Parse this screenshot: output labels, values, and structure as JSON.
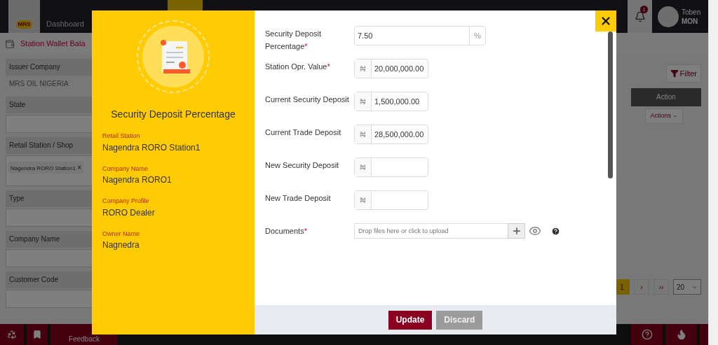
{
  "nav": {
    "logo_text": "MRS",
    "dashboard_label": "Dashboard",
    "notification_count": "1",
    "user": {
      "name": "Toben",
      "role": "MON"
    }
  },
  "page_title": "Station Wallet Bala",
  "filters": [
    {
      "label": "Issuer Company",
      "value": "MRS OIL NIGERIA",
      "kind": "text"
    },
    {
      "label": "State",
      "kind": "input"
    },
    {
      "label": "Retail Station / Shop",
      "kind": "chips",
      "chip": "Nagendra RORO Station1",
      "chip_remove": "×"
    },
    {
      "label": "Type",
      "kind": "input"
    },
    {
      "label": "Company Name",
      "kind": "input"
    },
    {
      "label": "Customer Code",
      "kind": "input"
    }
  ],
  "table": {
    "filter_button": "Filter",
    "column": "Action",
    "row_action": "Actions"
  },
  "pagination": {
    "current": "1",
    "next": "›",
    "last": "››",
    "page_size": "20"
  },
  "footer": {
    "feedback": "Feedback"
  },
  "modal": {
    "title": "Security Deposit Percentage",
    "info": [
      {
        "label": "Retail Station",
        "value": "Nagendra RORO Station1"
      },
      {
        "label": "Company Name",
        "value": "Nagendra RORO1"
      },
      {
        "label": "Company Profile",
        "value": "RORO Dealer"
      },
      {
        "label": "Owner Name",
        "value": "Nagnedra"
      }
    ],
    "fields": [
      {
        "kind": "percent",
        "label": "Security Deposit Percentage",
        "required_mark": "*",
        "value": "7.50",
        "addon": "%"
      },
      {
        "kind": "currency",
        "label": "Station Opr. Value",
        "required_mark": "*",
        "value": "20,000,000.00",
        "addon": "₦"
      },
      {
        "kind": "currency",
        "label": "Current Security Deposit",
        "value": "1,500,000.00",
        "addon": "₦"
      },
      {
        "kind": "currency",
        "label": "Current Trade Deposit",
        "value": "28,500,000.00",
        "addon": "₦"
      },
      {
        "kind": "currency",
        "label": "New Security Deposit",
        "addon": "₦"
      },
      {
        "kind": "currency",
        "label": "New Trade Deposit",
        "addon": "₦"
      },
      {
        "kind": "upload",
        "label": "Documents",
        "required_mark": "*",
        "placeholder": "Drop files here or click to upload"
      }
    ],
    "buttons": [
      {
        "kind": "primary",
        "label": "Update"
      },
      {
        "kind": "secondary",
        "label": "Discard"
      }
    ]
  }
}
